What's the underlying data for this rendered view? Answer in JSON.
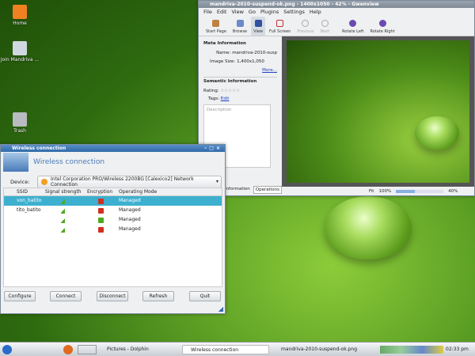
{
  "desktop": {
    "icons": [
      {
        "label": "Home"
      },
      {
        "label": "Join Mandriva ..."
      },
      {
        "label": "Trash"
      }
    ]
  },
  "gwenview": {
    "title": "mandriva-2010-suspend-ok.png - 1400x1050 - 42% - Gwenview",
    "menu": [
      "File",
      "Edit",
      "View",
      "Go",
      "Plugins",
      "Settings",
      "Help"
    ],
    "toolbar": [
      {
        "label": "Start Page",
        "icon": "home-icon"
      },
      {
        "label": "Browse",
        "icon": "browse-icon"
      },
      {
        "label": "View",
        "icon": "view-icon",
        "active": true
      },
      {
        "label": "Full Screen",
        "icon": "fullscreen-icon"
      },
      {
        "label": "Previous",
        "icon": "previous-icon",
        "disabled": true
      },
      {
        "label": "Next",
        "icon": "next-icon",
        "disabled": true
      },
      {
        "label": "Rotate Left",
        "icon": "rotate-left-icon"
      },
      {
        "label": "Rotate Right",
        "icon": "rotate-right-icon"
      }
    ],
    "meta": {
      "heading": "Meta Information",
      "name_label": "Name:",
      "name": "mandriva-2010-susp",
      "size_label": "Image Size:",
      "size": "1,400x1,050",
      "more": "More..."
    },
    "semantic": {
      "heading": "Semantic Information",
      "rating_label": "Rating:",
      "rating": 0,
      "tags_label": "Tags:",
      "tags_edit": "Edit",
      "description_placeholder": "Description"
    },
    "tabs": [
      "Information",
      "Operations"
    ],
    "status": {
      "fit": "Fit",
      "zoom_value": "100%",
      "zoom_percent": "40%",
      "zoom_slider": 40
    }
  },
  "wireless": {
    "title": "Wireless connection",
    "header": "Wireless connection",
    "device_label": "Device:",
    "device": "Intel Corporation PRO/Wireless 2200BG [Calexico2] Network Connection",
    "columns": [
      "SSID",
      "Signal strength",
      "Encryption",
      "Operating Mode"
    ],
    "rows": [
      {
        "ssid": "von_batito",
        "mode": "Managed",
        "encrypted": true,
        "selected": true
      },
      {
        "ssid": "tito_batito",
        "mode": "Managed",
        "encrypted": true
      },
      {
        "ssid": "",
        "mode": "Managed",
        "encrypted": false
      },
      {
        "ssid": "",
        "mode": "Managed",
        "encrypted": true
      }
    ],
    "buttons": [
      "Configure",
      "Connect",
      "Disconnect",
      "Refresh",
      "Quit"
    ]
  },
  "taskbar": {
    "tasks": [
      "Pictures - Dolphin",
      "Wireless connection",
      "mandriva-2010-suspend-ok.png"
    ],
    "clock": "02:33 pm"
  }
}
